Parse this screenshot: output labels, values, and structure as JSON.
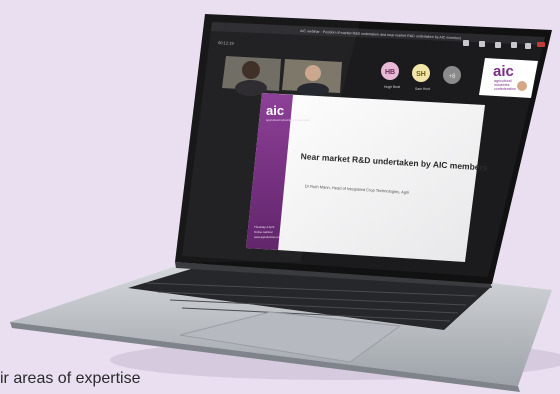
{
  "meeting": {
    "window_title": "AIC webinar - Position of market R&D undertaken and near market R&D undertaken by AIC members",
    "timer": "00:12:19",
    "toolbar": [
      "People",
      "Chat",
      "Reactions",
      "Rooms",
      "Apps",
      "More"
    ],
    "participants": [
      {
        "initials": "HB",
        "label": "Hugh Beat",
        "color": "#e8b9d6"
      },
      {
        "initials": "SH",
        "label": "Sam Hunt",
        "color": "#f1e6a8"
      },
      {
        "initials": "+8",
        "label": "",
        "color": "#8a8a8a"
      }
    ]
  },
  "slide": {
    "brand": "aic",
    "brand_sub": "agricultural industries confederation",
    "title": "Near market R&D undertaken by AIC members",
    "presenter": "Dr Ruth Mann, Head of Integrated Crop Technologies, Agrii",
    "footer_lines": [
      "Thursday 4 April",
      "Online webinar",
      "www.agindustries.org.uk"
    ]
  },
  "thumbnail": {
    "brand": "aic",
    "lines": [
      "agricultural",
      "industries",
      "confederation"
    ]
  },
  "caption": {
    "text": "ir areas of expertise"
  },
  "colors": {
    "background": "#e9dff0",
    "aic_purple": "#7b2d86",
    "bezel": "#111111",
    "laptop_silver": "#c9ccd1"
  }
}
